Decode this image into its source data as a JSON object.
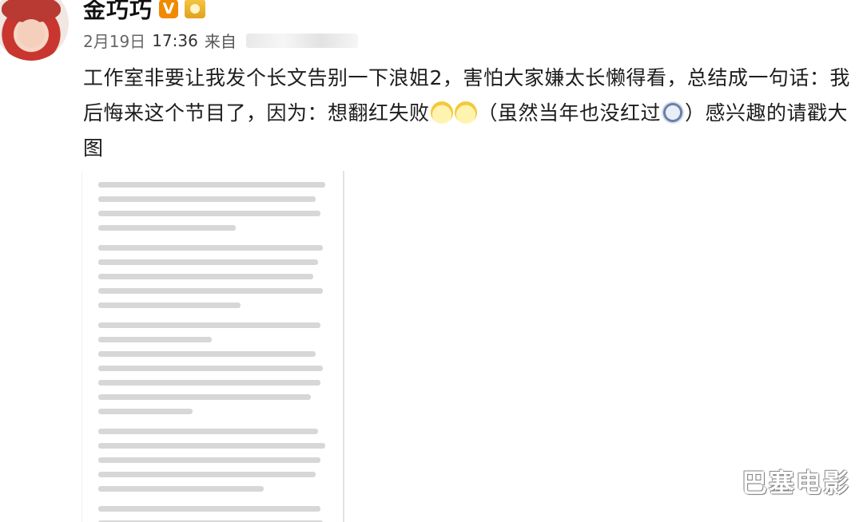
{
  "post": {
    "username": "金巧巧",
    "verified_badge": "V",
    "date": "2月19日",
    "time": "17:36",
    "source_prefix": "来自",
    "text_segments": [
      "工作室非要让我发个长文告别一下浪姐2，害怕大家嫌太长懒得看，总结成一句话：我后悔来这个节目了，因为：想翻红失败",
      "（虽然当年也没红过",
      "）感兴趣的请戳大图"
    ],
    "emojis": [
      "bear-emoji",
      "bear-emoji",
      "crying-emoji"
    ]
  },
  "watermark": "巴塞电影",
  "colors": {
    "text": "#1d1d1d",
    "meta": "#666666",
    "vip_badge": "#f08a00"
  }
}
